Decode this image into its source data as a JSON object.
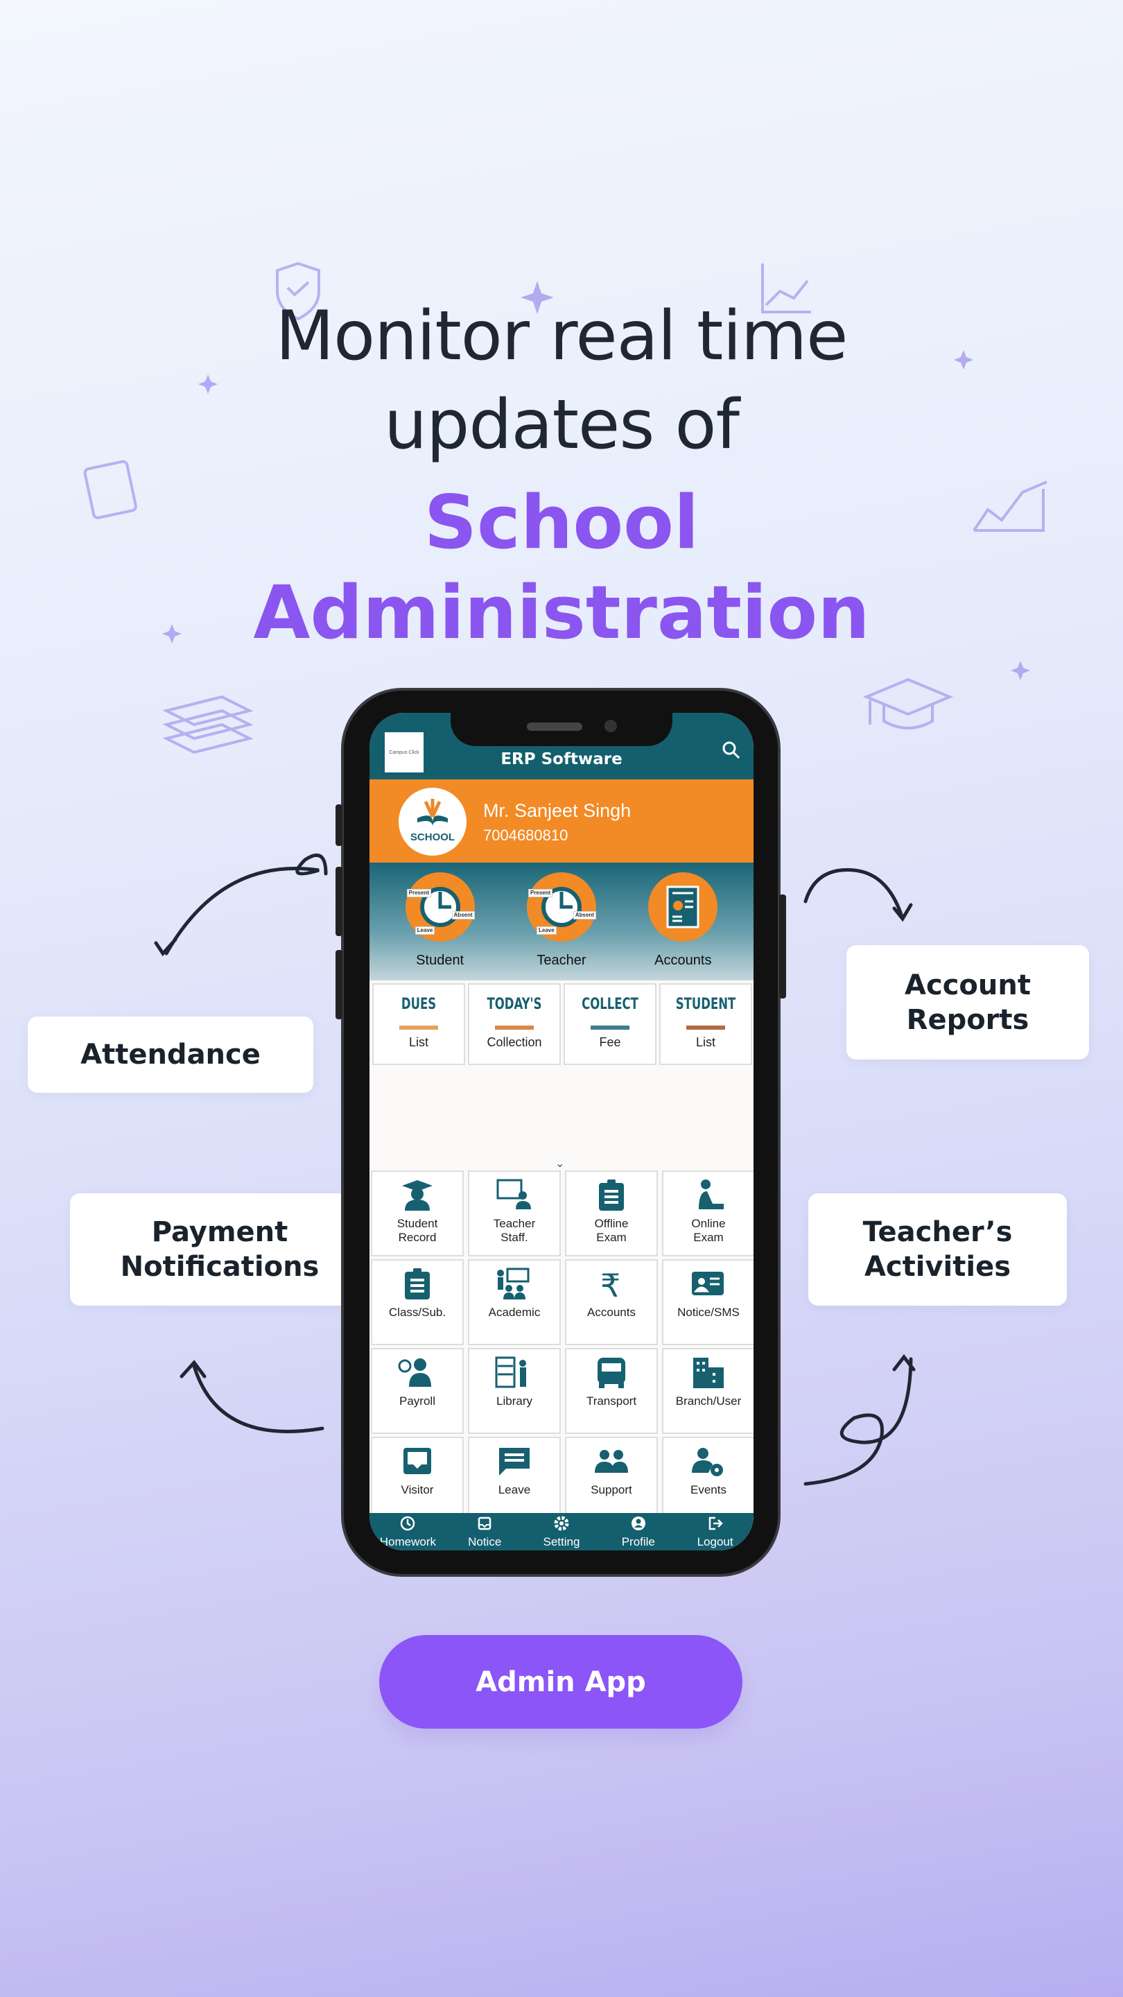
{
  "headline": {
    "line1": "Monitor real time",
    "line2": "updates of",
    "line3": "School",
    "line4": "Administration"
  },
  "features": {
    "attendance": "Attendance",
    "account_reports": "Account Reports",
    "payment_notifications": "Payment Notifications",
    "teacher_activities": "Teacher’s Activities"
  },
  "app": {
    "title": "ERP Software",
    "logo_text": "Campus Click",
    "user_name": "Mr. Sanjeet Singh",
    "phone": "7004680810",
    "school_logo_text": "SCHOOL",
    "summary": [
      {
        "label": "Student"
      },
      {
        "label": "Teacher"
      },
      {
        "label": "Accounts"
      }
    ],
    "attendance_tags": [
      "Present",
      "Absent",
      "Leave"
    ],
    "quick_cards": [
      {
        "title": "DUES",
        "sub": "List",
        "color": "#e6a25c"
      },
      {
        "title": "TODAY'S",
        "sub": "Collection",
        "color": "#d9874a"
      },
      {
        "title": "COLLECT",
        "sub": "Fee",
        "color": "#3d7f8c"
      },
      {
        "title": "STUDENT",
        "sub": "List",
        "color": "#b06a45"
      }
    ],
    "modules": [
      {
        "l1": "Student",
        "l2": "Record",
        "icon": "graduate-icon"
      },
      {
        "l1": "Teacher",
        "l2": "Staff.",
        "icon": "teacher-board-icon"
      },
      {
        "l1": "Offline",
        "l2": "Exam",
        "icon": "clipboard-icon"
      },
      {
        "l1": "Online",
        "l2": "Exam",
        "icon": "person-writing-icon"
      },
      {
        "l1": "Class/Sub.",
        "l2": "",
        "icon": "clipboard-icon"
      },
      {
        "l1": "Academic",
        "l2": "",
        "icon": "classroom-icon"
      },
      {
        "l1": "Accounts",
        "l2": "",
        "icon": "rupee-icon"
      },
      {
        "l1": "Notice/SMS",
        "l2": "",
        "icon": "id-card-icon"
      },
      {
        "l1": "Payroll",
        "l2": "",
        "icon": "payroll-icon"
      },
      {
        "l1": "Library",
        "l2": "",
        "icon": "library-icon"
      },
      {
        "l1": "Transport",
        "l2": "",
        "icon": "bus-icon"
      },
      {
        "l1": "Branch/User",
        "l2": "",
        "icon": "building-icon"
      },
      {
        "l1": "Visitor",
        "l2": "",
        "icon": "inbox-icon"
      },
      {
        "l1": "Leave",
        "l2": "",
        "icon": "message-icon"
      },
      {
        "l1": "Support",
        "l2": "",
        "icon": "group-icon"
      },
      {
        "l1": "Events",
        "l2": "",
        "icon": "user-gear-icon"
      }
    ],
    "bottom_nav": [
      {
        "label": "Homework",
        "icon": "clock-icon"
      },
      {
        "label": "Notice",
        "icon": "inbox-icon"
      },
      {
        "label": "Setting",
        "icon": "gear-icon"
      },
      {
        "label": "Profile",
        "icon": "account-circle-icon"
      },
      {
        "label": "Logout",
        "icon": "logout-icon"
      }
    ]
  },
  "cta": {
    "label": "Admin App"
  },
  "colors": {
    "accent": "#8b55f0",
    "teal": "#145f6e",
    "orange": "#f28a25",
    "text": "#1e2733"
  }
}
